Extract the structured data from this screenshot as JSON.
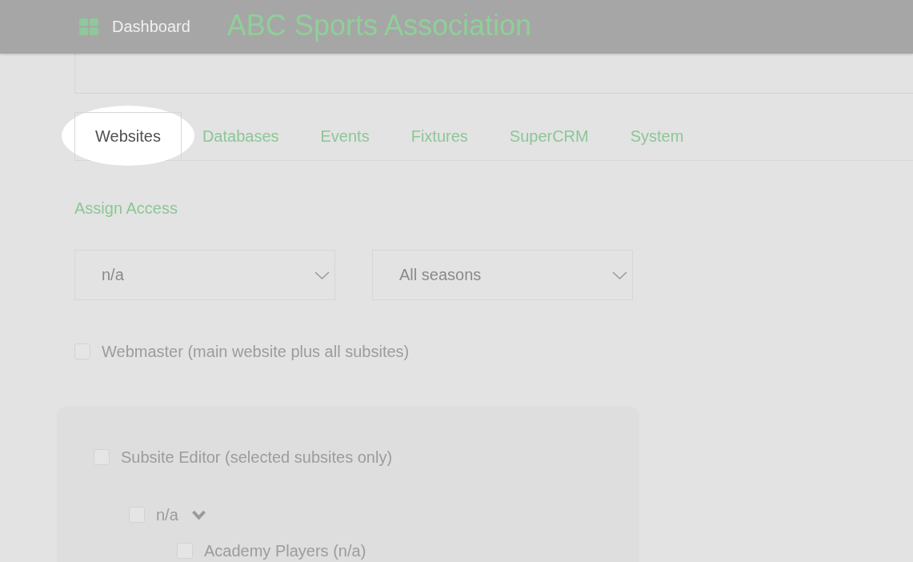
{
  "header": {
    "dashboard_link": "Dashboard",
    "site_title": "ABC Sports Association"
  },
  "tabs": [
    {
      "label": "Websites",
      "selected": true,
      "spotlight": true
    },
    {
      "label": "Databases",
      "selected": false,
      "spotlight": false
    },
    {
      "label": "Events",
      "selected": false,
      "spotlight": false
    },
    {
      "label": "Fixtures",
      "selected": false,
      "spotlight": false
    },
    {
      "label": "SuperCRM",
      "selected": false,
      "spotlight": false
    },
    {
      "label": "System",
      "selected": false,
      "spotlight": false
    }
  ],
  "section_link": "Assign Access",
  "selects": [
    {
      "value": "n/a"
    },
    {
      "value": "All seasons"
    }
  ],
  "webmaster": {
    "label": "Webmaster (main website plus all subsites)",
    "checked": false,
    "disabled": true
  },
  "subsite_panel": {
    "label": "Subsite Editor (selected subsites only)",
    "checked": false,
    "disabled": true,
    "children": [
      {
        "label": "n/a",
        "checked": false,
        "disabled": true,
        "expanded": true,
        "children": [
          {
            "label": "Academy Players (n/a)",
            "checked": false,
            "disabled": true
          }
        ]
      }
    ]
  }
}
